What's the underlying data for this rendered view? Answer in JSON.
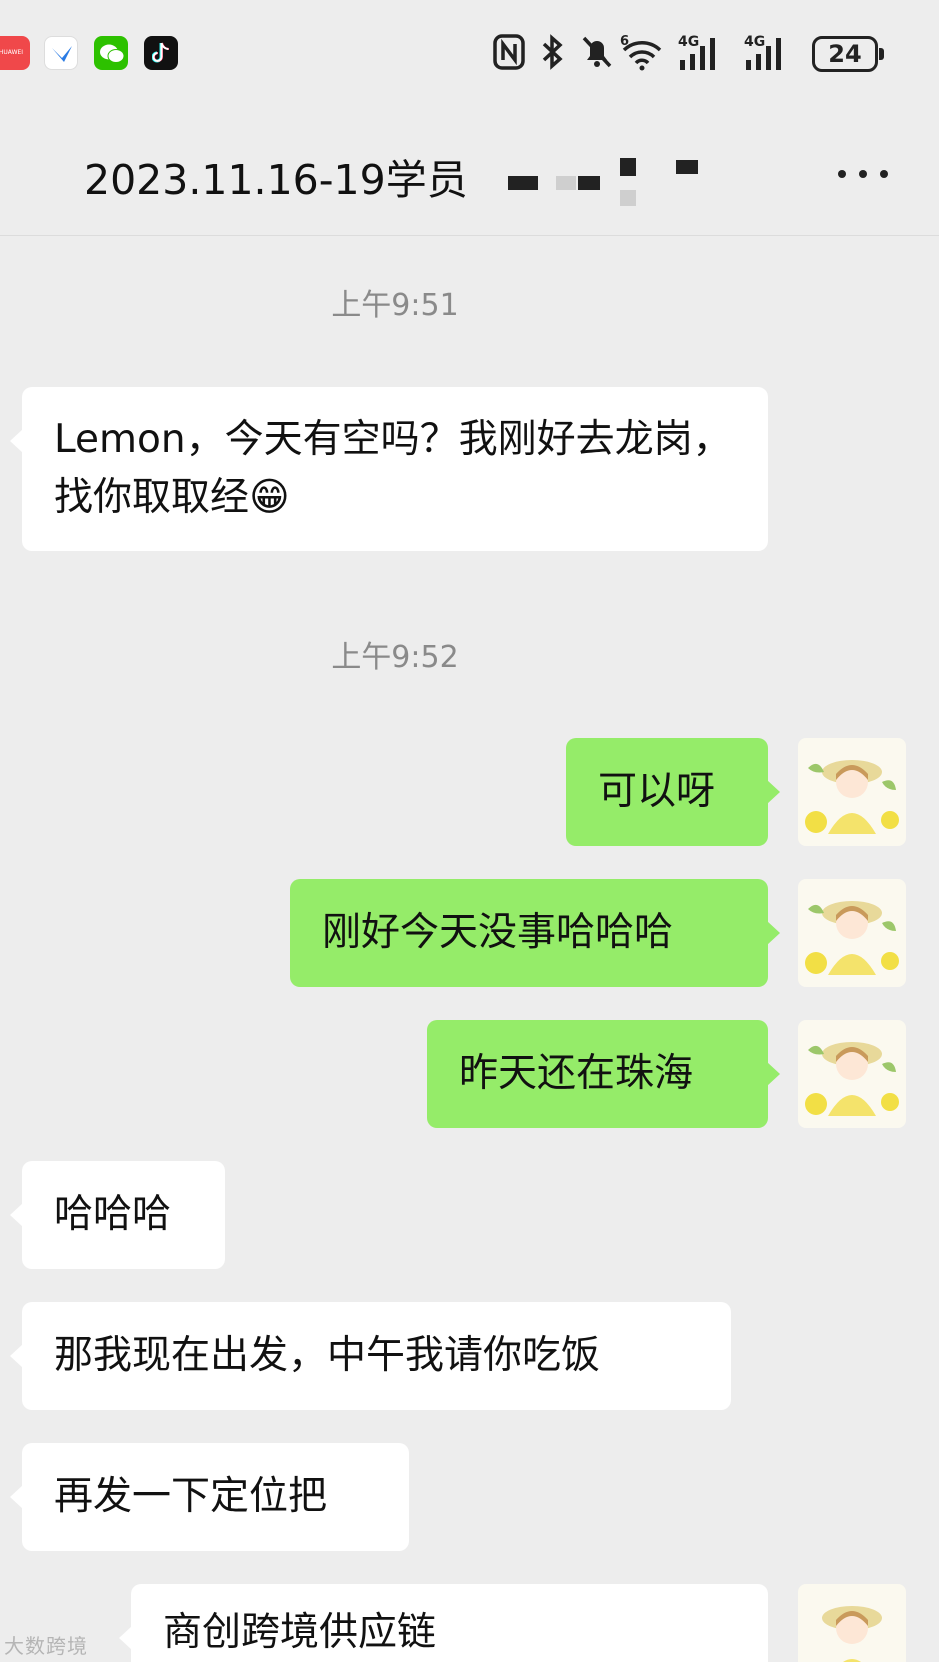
{
  "status_bar": {
    "app_icons": [
      "huawei-icon",
      "bird-app-icon",
      "wechat-icon",
      "tiktok-icon"
    ],
    "huawei_label": "HUAWEI",
    "system_icons": [
      "nfc-icon",
      "bluetooth-icon",
      "mute-bell-icon",
      "wifi-icon",
      "signal-4g-icon",
      "signal-4g-icon"
    ],
    "wifi_badge": "6",
    "network_label_1": "4G",
    "network_label_2": "4G",
    "battery": "24"
  },
  "header": {
    "title": "2023.11.16-19学员",
    "more_icon": "more-dots-icon"
  },
  "messages": [
    {
      "type": "timestamp",
      "text": "上午9:51"
    },
    {
      "type": "in",
      "text": "Lemon，今天有空吗？我刚好去龙岗，找你取取经",
      "emoji": "😁"
    },
    {
      "type": "timestamp",
      "text": "上午9:52"
    },
    {
      "type": "out",
      "text": "可以呀"
    },
    {
      "type": "out",
      "text": "刚好今天没事哈哈哈"
    },
    {
      "type": "out",
      "text": "昨天还在珠海"
    },
    {
      "type": "in",
      "text": "哈哈哈"
    },
    {
      "type": "in",
      "text": "那我现在出发，中午我请你吃饭"
    },
    {
      "type": "in",
      "text": "再发一下定位把"
    },
    {
      "type": "out",
      "text": "商创跨境供应链"
    }
  ],
  "watermark": "大数跨境",
  "colors": {
    "background": "#ededed",
    "incoming_bubble": "#ffffff",
    "outgoing_bubble": "#95ec69",
    "timestamp_text": "#8a8a8a"
  }
}
